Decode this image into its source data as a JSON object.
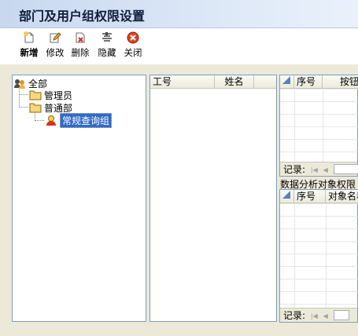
{
  "window": {
    "title": "部门及用户组权限设置"
  },
  "toolbar": {
    "items": [
      {
        "label": "新增",
        "icon": "new-document-icon",
        "bold": true
      },
      {
        "label": "修改",
        "icon": "edit-icon"
      },
      {
        "label": "删除",
        "icon": "delete-document-icon"
      },
      {
        "label": "隐藏",
        "icon": "hide-icon"
      },
      {
        "label": "关闭",
        "icon": "close-circle-icon"
      }
    ]
  },
  "tree": {
    "root": "全部",
    "nodes": [
      {
        "label": "管理员",
        "type": "folder"
      },
      {
        "label": "普通部",
        "type": "folder"
      },
      {
        "label": "常规查询组",
        "type": "group",
        "selected": true
      }
    ]
  },
  "users_grid": {
    "columns": [
      "工号",
      "姓名"
    ]
  },
  "permissions_grid": {
    "columns": [
      "序号",
      "按钮"
    ],
    "footer_label": "记录:"
  },
  "data_objects": {
    "section_title": "数据分析对象权限",
    "columns": [
      "序号",
      "对象名称"
    ],
    "footer_label": "记录:"
  },
  "colors": {
    "title_bar": "#c7d8ef",
    "selection": "#316ac5",
    "panel_border": "#7f9db9",
    "background": "#ece9d8"
  }
}
